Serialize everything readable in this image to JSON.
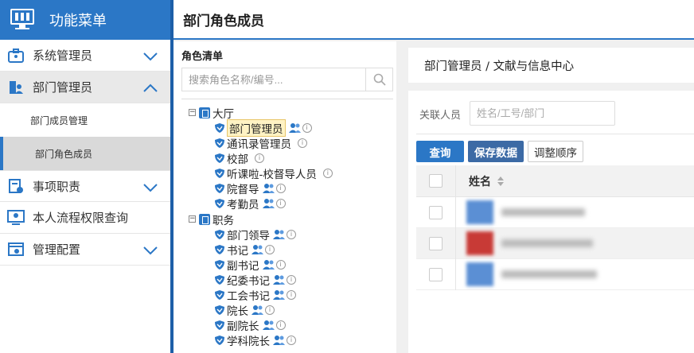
{
  "sidebar": {
    "header_title": "功能菜单",
    "items": [
      {
        "label": "系统管理员"
      },
      {
        "label": "部门管理员"
      },
      {
        "label": "事项职责"
      },
      {
        "label": "本人流程权限查询"
      },
      {
        "label": "管理配置"
      }
    ],
    "subitems": [
      {
        "label": "部门成员管理"
      },
      {
        "label": "部门角色成员"
      }
    ]
  },
  "page": {
    "title": "部门角色成员"
  },
  "roles": {
    "caption": "角色清单",
    "search_placeholder": "搜索角色名称/编号...",
    "tree": [
      {
        "label": "大厅"
      },
      {
        "label": "部门管理员"
      },
      {
        "label": "通讯录管理员"
      },
      {
        "label": "校部"
      },
      {
        "label": "听课啦-校督导人员"
      },
      {
        "label": "院督导"
      },
      {
        "label": "考勤员"
      },
      {
        "label": "职务"
      },
      {
        "label": "部门领导"
      },
      {
        "label": "书记"
      },
      {
        "label": "副书记"
      },
      {
        "label": "纪委书记"
      },
      {
        "label": "工会书记"
      },
      {
        "label": "院长"
      },
      {
        "label": "副院长"
      },
      {
        "label": "学科院长"
      }
    ]
  },
  "detail": {
    "breadcrumb": "部门管理员 / 文献与信息中心",
    "filter_label": "关联人员",
    "filter_placeholder": "姓名/工号/部门",
    "buttons": {
      "query": "查询",
      "save": "保存数据",
      "reorder": "调整顺序"
    },
    "table": {
      "name_header": "姓名"
    }
  },
  "colors": {
    "brand": "#2b77c6",
    "avatar_colors": [
      "#5b8fd4",
      "#c83a36",
      "#5b8fd4"
    ]
  }
}
